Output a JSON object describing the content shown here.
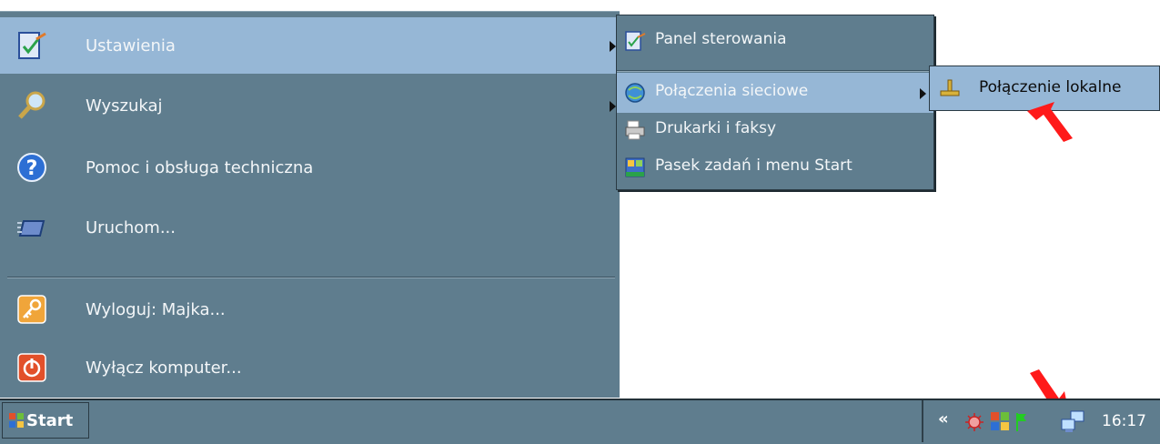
{
  "start_menu": {
    "items": [
      {
        "label": "Ustawienia",
        "icon": "settings-icon"
      },
      {
        "label": "Wyszukaj",
        "icon": "search-icon"
      },
      {
        "label": "Pomoc i obsługa techniczna",
        "icon": "help-icon"
      },
      {
        "label": "Uruchom...",
        "icon": "run-icon"
      },
      {
        "label": "Wyloguj: Majka...",
        "icon": "logoff-key-icon"
      },
      {
        "label": "Wyłącz komputer...",
        "icon": "power-icon"
      }
    ]
  },
  "settings_submenu": {
    "items": [
      {
        "label": "Panel sterowania",
        "icon": "control-panel-icon"
      },
      {
        "label": "Połączenia sieciowe",
        "icon": "network-connections-icon"
      },
      {
        "label": "Drukarki i faksy",
        "icon": "printer-icon"
      },
      {
        "label": "Pasek zadań i menu Start",
        "icon": "taskbar-icon"
      }
    ]
  },
  "network_submenu": {
    "items": [
      {
        "label": "Połączenie lokalne",
        "icon": "local-connection-icon"
      }
    ]
  },
  "taskbar": {
    "start_label": "Start",
    "tray_collapse": "«",
    "clock": "16:17"
  },
  "colors": {
    "menu_bg": "#5f7d8e",
    "highlight": "#96b7d6",
    "arrow_annotation": "#ff1a1a"
  }
}
